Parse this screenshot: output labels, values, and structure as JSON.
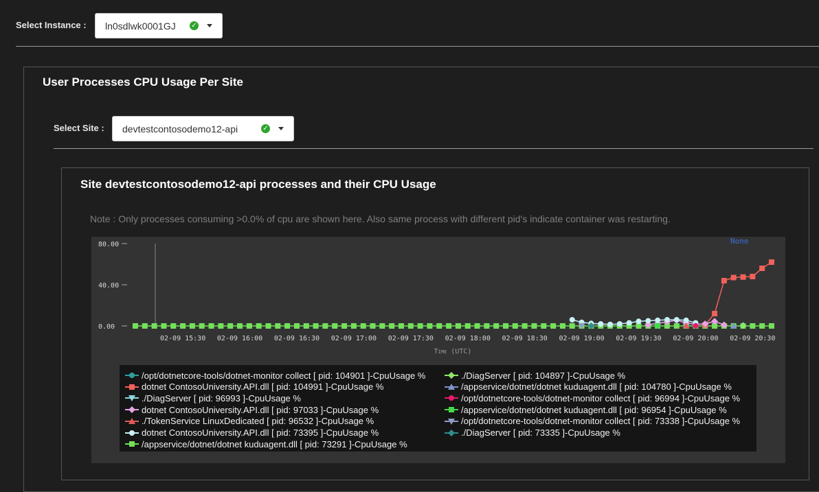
{
  "instance": {
    "label": "Select Instance :",
    "value": "ln0sdlwk0001GJ"
  },
  "panel": {
    "title": "User Processes CPU Usage Per Site",
    "site_label": "Select Site :",
    "site_value": "devtestcontosodemo12-api"
  },
  "subpanel": {
    "title": "Site devtestcontosodemo12-api processes and their CPU Usage",
    "note": "Note : Only processes consuming >0.0% of cpu are shown here. Also same process with different pid's indicate container was restarting."
  },
  "chart_data": {
    "type": "line",
    "corner_label": "None",
    "xlabel": "Time (UTC)",
    "ylabel": "",
    "ylim": [
      0,
      80
    ],
    "yticks": [
      "0.00",
      "40.00",
      "80.00"
    ],
    "x": [
      "15:05",
      "15:10",
      "15:15",
      "15:20",
      "15:25",
      "15:30",
      "15:35",
      "15:40",
      "15:45",
      "15:50",
      "15:55",
      "16:00",
      "16:05",
      "16:10",
      "16:15",
      "16:20",
      "16:25",
      "16:30",
      "16:35",
      "16:40",
      "16:45",
      "16:50",
      "16:55",
      "17:00",
      "17:05",
      "17:10",
      "17:15",
      "17:20",
      "17:25",
      "17:30",
      "17:35",
      "17:40",
      "17:45",
      "17:50",
      "17:55",
      "18:00",
      "18:05",
      "18:10",
      "18:15",
      "18:20",
      "18:25",
      "18:30",
      "18:35",
      "18:40",
      "18:45",
      "18:50",
      "18:55",
      "19:00",
      "19:05",
      "19:10",
      "19:15",
      "19:20",
      "19:25",
      "19:30",
      "19:35",
      "19:40",
      "19:45",
      "19:50",
      "19:55",
      "20:00",
      "20:05",
      "20:10",
      "20:15",
      "20:20",
      "20:25",
      "20:30",
      "20:35",
      "20:40"
    ],
    "xticks": [
      "02-09 15:30",
      "02-09 16:00",
      "02-09 16:30",
      "02-09 17:00",
      "02-09 17:30",
      "02-09 18:00",
      "02-09 18:30",
      "02-09 19:00",
      "02-09 19:30",
      "02-09 20:00",
      "02-09 20:30"
    ],
    "series": [
      {
        "name": "/opt/dotnetcore-tools/dotnet-monitor collect [ pid: 104901 ]-CpuUsage %",
        "color": "#2f9e9e",
        "marker": "circle",
        "points": [
          [
            "20:25",
            0.6
          ]
        ]
      },
      {
        "name": "dotnet ContosoUniversity.API.dll [ pid: 104991 ]-CpuUsage %",
        "color": "#f0625a",
        "marker": "square",
        "points": [
          [
            "20:05",
            1.0
          ],
          [
            "20:10",
            12.0
          ],
          [
            "20:15",
            44.0
          ],
          [
            "20:20",
            47.0
          ],
          [
            "20:25",
            47.5
          ],
          [
            "20:30",
            48.0
          ],
          [
            "20:35",
            56.0
          ],
          [
            "20:40",
            62.0
          ]
        ]
      },
      {
        "name": "./DiagServer [ pid: 96993 ]-CpuUsage %",
        "color": "#8fd6e0",
        "marker": "triangle-down",
        "points": [
          [
            "19:55",
            0.4
          ]
        ]
      },
      {
        "name": "dotnet ContosoUniversity.API.dll [ pid: 97033 ]-CpuUsage %",
        "color": "#e7a3e3",
        "marker": "diamond",
        "points": [
          [
            "19:35",
            1.2
          ],
          [
            "19:40",
            2.5
          ],
          [
            "19:45",
            4.0
          ],
          [
            "19:50",
            5.5
          ],
          [
            "19:55",
            3.0
          ],
          [
            "20:00",
            1.5
          ],
          [
            "20:05",
            2.0
          ],
          [
            "20:10",
            4.5
          ],
          [
            "20:15",
            1.0
          ]
        ]
      },
      {
        "name": "./TokenService LinuxDedicated [ pid: 96532 ]-CpuUsage %",
        "color": "#e05a5a",
        "marker": "triangle-up",
        "points": [
          [
            "19:55",
            0.3
          ]
        ]
      },
      {
        "name": "dotnet ContosoUniversity.API.dll [ pid: 73395 ]-CpuUsage %",
        "color": "#c8f0f5",
        "marker": "circle",
        "points": [
          [
            "18:55",
            6.0
          ],
          [
            "19:00",
            3.5
          ],
          [
            "19:05",
            2.5
          ],
          [
            "19:10",
            2.0
          ],
          [
            "19:15",
            1.5
          ],
          [
            "19:20",
            2.0
          ],
          [
            "19:25",
            3.0
          ],
          [
            "19:30",
            4.5
          ],
          [
            "19:35",
            5.0
          ],
          [
            "19:40",
            5.5
          ],
          [
            "19:45",
            6.0
          ],
          [
            "19:50",
            6.0
          ],
          [
            "19:55",
            5.5
          ],
          [
            "20:00",
            3.0
          ]
        ]
      },
      {
        "name": "/appservice/dotnet/dotnet kuduagent.dll [ pid: 73291 ]-CpuUsage %",
        "color": "#73e05a",
        "marker": "square",
        "points": "zero-all"
      },
      {
        "name": "./DiagServer [ pid: 104897 ]-CpuUsage %",
        "color": "#8ee86a",
        "marker": "diamond",
        "points": [
          [
            "20:25",
            0.3
          ]
        ]
      },
      {
        "name": "/appservice/dotnet/dotnet kuduagent.dll [ pid: 104780 ]-CpuUsage %",
        "color": "#7f93c8",
        "marker": "triangle-up",
        "points": [
          [
            "20:20",
            0.2
          ]
        ]
      },
      {
        "name": "/opt/dotnetcore-tools/dotnet-monitor collect [ pid: 96994 ]-CpuUsage %",
        "color": "#e8186d",
        "marker": "circle",
        "points": [
          [
            "20:00",
            0.2
          ]
        ]
      },
      {
        "name": "/appservice/dotnet/dotnet kuduagent.dll [ pid: 96954 ]-CpuUsage %",
        "color": "#45d94a",
        "marker": "square",
        "points": [
          [
            "19:40",
            0.1
          ]
        ]
      },
      {
        "name": "/opt/dotnetcore-tools/dotnet-monitor collect [ pid: 73338 ]-CpuUsage %",
        "color": "#8f9cc8",
        "marker": "triangle-down",
        "points": [
          [
            "19:00",
            0.2
          ]
        ]
      },
      {
        "name": "./DiagServer [ pid: 73335 ]-CpuUsage %",
        "color": "#2f8f8a",
        "marker": "diamond",
        "points": [
          [
            "19:05",
            0.2
          ]
        ]
      }
    ]
  }
}
